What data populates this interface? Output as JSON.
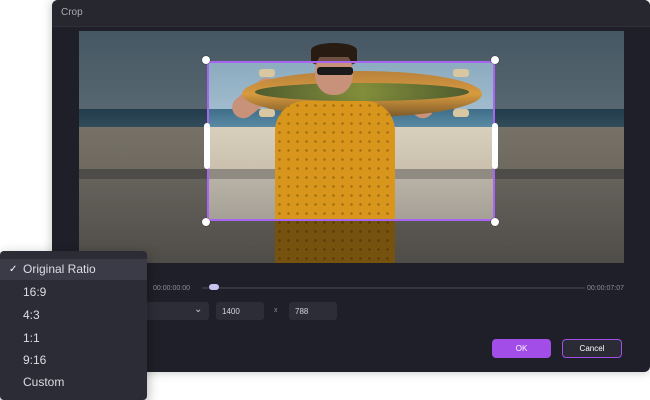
{
  "window": {
    "title": "Crop"
  },
  "player": {
    "time_current": "00:00:00:00",
    "time_total": "00:00:07:07",
    "progress": 0.0
  },
  "size": {
    "width": "1400",
    "times_sign": "x",
    "height": "788"
  },
  "buttons": {
    "ok": "OK",
    "cancel": "Cancel"
  },
  "ratio_menu": {
    "selected_mark": "✓",
    "items": [
      "Original Ratio",
      "16:9",
      "4:3",
      "1:1",
      "9:16",
      "Custom"
    ]
  },
  "colors": {
    "accent": "#a24de8",
    "crop_border": "#a865f2",
    "dialog_bg": "#1e1f28",
    "menu_bg": "#2b2c36"
  }
}
